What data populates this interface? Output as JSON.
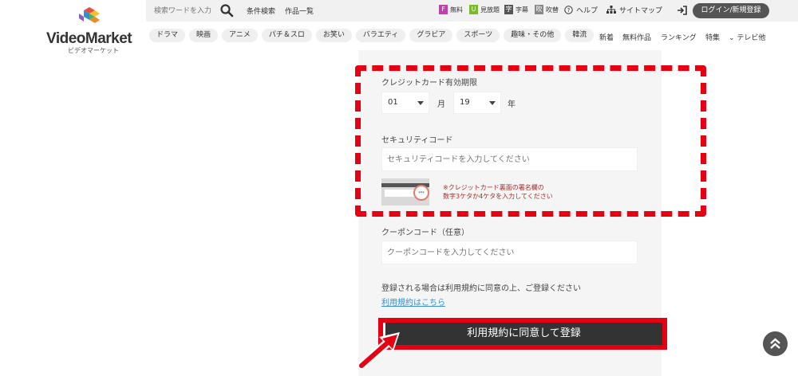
{
  "header": {
    "logo_text": "VideoMarket",
    "logo_sub": "ビデオマーケット",
    "search": {
      "placeholder": "検索ワードを入力"
    },
    "top_links": {
      "filter": "条件検索",
      "works": "作品一覧"
    },
    "badges": [
      {
        "letter": "F",
        "label": "無料",
        "color": "#c040b0"
      },
      {
        "letter": "U",
        "label": "見放題",
        "color": "#7cb832"
      },
      {
        "letter": "字",
        "label": "字幕",
        "color": "#555555"
      },
      {
        "letter": "吹",
        "label": "吹替",
        "color": "#888888"
      }
    ],
    "help": "ヘルプ",
    "sitemap": "サイトマップ",
    "login": "ログイン/新規登録"
  },
  "nav": {
    "categories": [
      "ドラマ",
      "映画",
      "アニメ",
      "パチ＆スロ",
      "お笑い",
      "バラエティ",
      "グラビア",
      "スポーツ",
      "趣味・その他",
      "韓流"
    ],
    "right": {
      "new": "新着",
      "free": "無料作品",
      "ranking": "ランキング",
      "special": "特集",
      "more": "テレビ他"
    }
  },
  "form": {
    "expiry_label": "クレジットカード有効期限",
    "month_value": "01",
    "month_unit": "月",
    "year_value": "19",
    "year_unit": "年",
    "security_label": "セキュリティコード",
    "security_placeholder": "セキュリティコードを入力してください",
    "card_dots": "***",
    "security_note_1": "※クレジットカード裏面の署名欄の",
    "security_note_2": "数字3ケタか4ケタを入力してください",
    "coupon_label": "クーポンコード（任意）",
    "coupon_placeholder": "クーポンコードを入力してください",
    "terms_text": "登録される場合は利用規約に同意の上、ご登録ください",
    "terms_link": "利用規約はこちら",
    "submit": "利用規約に同意して登録"
  },
  "colors": {
    "annotation": "#e60012",
    "link": "#3a8fd6",
    "note": "#a0302a"
  }
}
